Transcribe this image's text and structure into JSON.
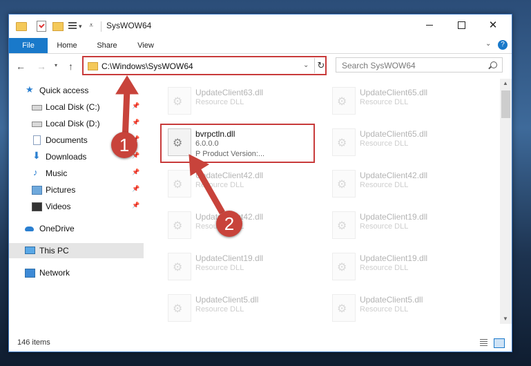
{
  "window": {
    "title": "SysWOW64"
  },
  "ribbon": {
    "tabs": [
      "File",
      "Home",
      "Share",
      "View"
    ]
  },
  "address": {
    "path": "C:\\Windows\\SysWOW64"
  },
  "search": {
    "placeholder": "Search SysWOW64"
  },
  "sidebar": {
    "items": [
      {
        "label": "Quick access",
        "pinned": false
      },
      {
        "label": "Local Disk (C:)",
        "pinned": true
      },
      {
        "label": "Local Disk (D:)",
        "pinned": true
      },
      {
        "label": "Documents",
        "pinned": true
      },
      {
        "label": "Downloads",
        "pinned": true
      },
      {
        "label": "Music",
        "pinned": true
      },
      {
        "label": "Pictures",
        "pinned": true
      },
      {
        "label": "Videos",
        "pinned": true
      },
      {
        "label": "OneDrive",
        "pinned": false
      },
      {
        "label": "This PC",
        "pinned": false,
        "selected": true
      },
      {
        "label": "Network",
        "pinned": false
      }
    ]
  },
  "files": {
    "highlighted": {
      "name": "bvrpctln.dll",
      "version": "6.0.0.0",
      "detail": "P   Product Version:..."
    },
    "background": [
      {
        "name": "UpdateClient63.dll",
        "type": "Resource DLL"
      },
      {
        "name": "UpdateClient65.dll",
        "type": "Resource DLL"
      },
      {
        "name": "UpdateClient65.dll",
        "type": "Resource DLL"
      },
      {
        "name": "UpdateClient42.dll",
        "type": "Resource DLL"
      },
      {
        "name": "UpdateClient42.dll",
        "type": "Resource DLL"
      },
      {
        "name": "UpdateClient42.dll",
        "type": "Resource DLL"
      },
      {
        "name": "UpdateClient19.dll",
        "type": "Resource DLL"
      },
      {
        "name": "UpdateClient19.dll",
        "type": "Resource DLL"
      },
      {
        "name": "UpdateClient19.dll",
        "type": "Resource DLL"
      },
      {
        "name": "UpdateClient5.dll",
        "type": "Resource DLL"
      },
      {
        "name": "UpdateClient5.dll",
        "type": "Resource DLL"
      }
    ]
  },
  "status": {
    "count": "146 items"
  },
  "annotations": {
    "step1": "1",
    "step2": "2",
    "color": "#c8433b"
  },
  "colors": {
    "accent": "#1979ca",
    "highlight_border": "#c83a3a"
  }
}
